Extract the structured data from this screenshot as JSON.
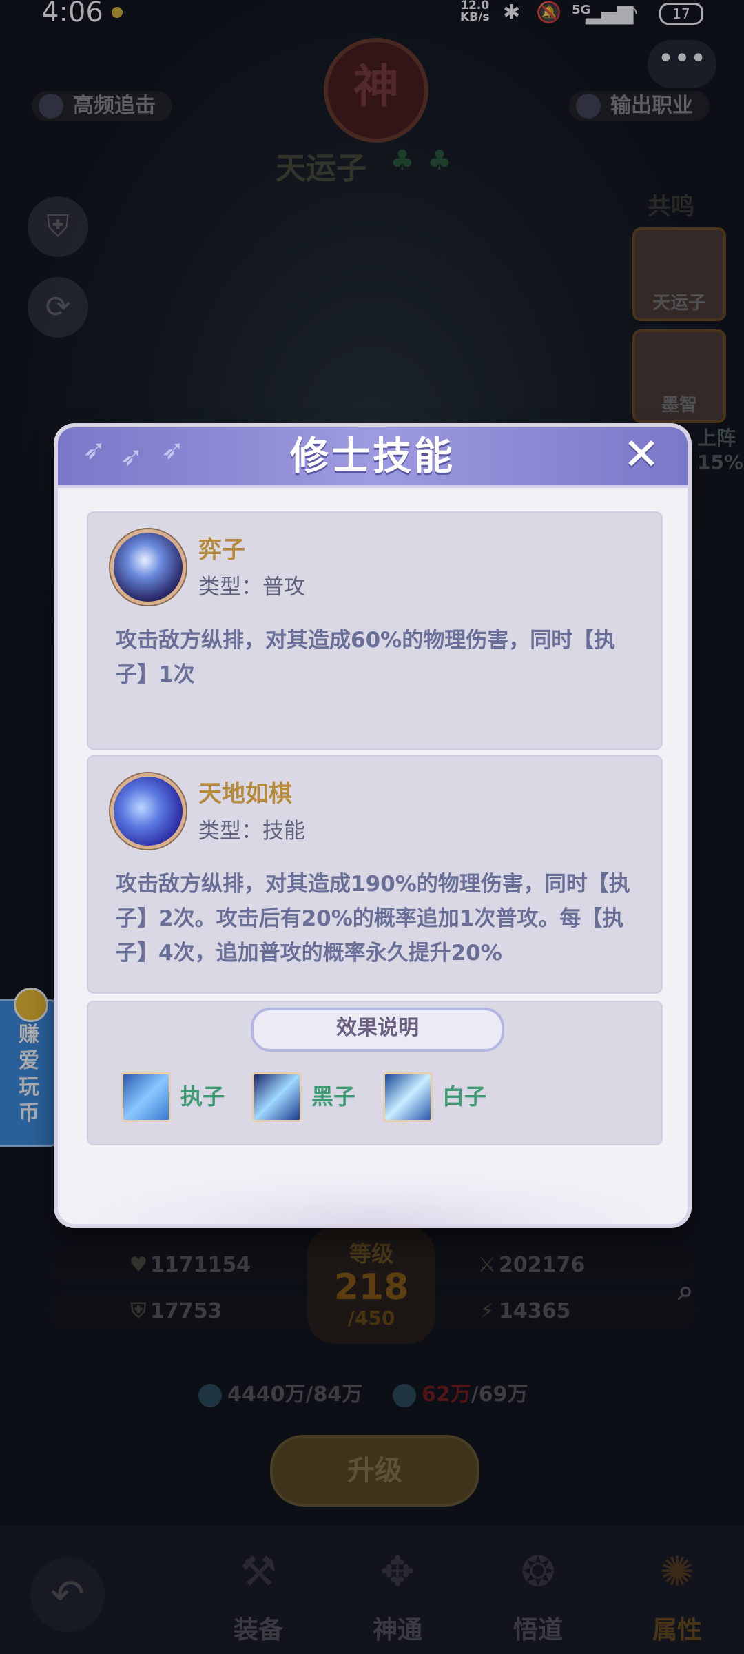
{
  "status_bar": {
    "time": "4:06",
    "net_speed_value": "12.0",
    "net_speed_unit": "KB/s",
    "network": "5G",
    "battery": "17"
  },
  "background": {
    "top_left_tag": "高频追击",
    "top_right_tag": "输出职业",
    "god_emblem": "神",
    "hero_name": "天运子",
    "resonance_label": "共鸣",
    "portraits": [
      "天运子",
      "墨智"
    ],
    "side_fragment_1": "上阵",
    "side_fragment_2": "15%",
    "stats": {
      "hp": "1171154",
      "attack": "202176",
      "defense": "17753",
      "speed": "14365"
    },
    "level": {
      "label": "等级",
      "value": "218",
      "max": "/450"
    },
    "resources": {
      "res1": "4440万/84万",
      "res2_current": "62万",
      "res2_rest": "/69万"
    },
    "upgrade_label": "升级",
    "earn_tab_label": "赚爱玩币"
  },
  "bottom_nav": {
    "items": [
      {
        "label": "装备"
      },
      {
        "label": "神通"
      },
      {
        "label": "悟道"
      },
      {
        "label": "属性"
      }
    ]
  },
  "modal": {
    "title": "修士技能",
    "skills": [
      {
        "name": "弈子",
        "type": "类型：普攻",
        "description": "攻击敌方纵排，对其造成60%的物理伤害，同时【执子】1次"
      },
      {
        "name": "天地如棋",
        "type": "类型：技能",
        "description": "攻击敌方纵排，对其造成190%的物理伤害，同时【执子】2次。攻击后有20%的概率追加1次普攻。每【执子】4次，追加普攻的概率永久提升20%"
      }
    ],
    "effects": {
      "heading": "效果说明",
      "items": [
        "执子",
        "黑子",
        "白子"
      ]
    }
  }
}
